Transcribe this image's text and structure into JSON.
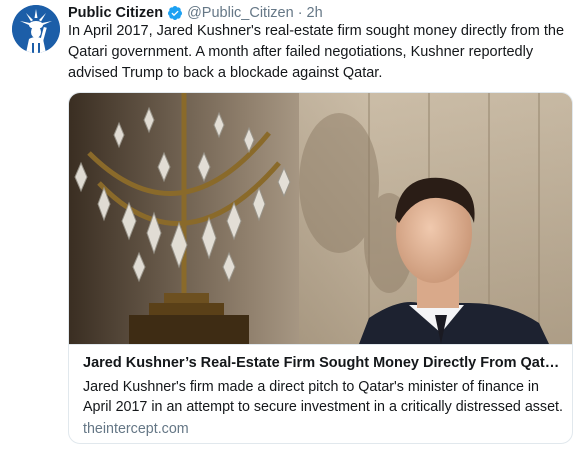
{
  "tweet": {
    "author_name": "Public Citizen",
    "handle": "@Public_Citizen",
    "separator": "·",
    "time": "2h",
    "verified": true,
    "verified_icon": "verified-badge-icon",
    "avatar_icon": "statue-of-liberty-logo",
    "text": "In April 2017, Jared Kushner's real-estate firm sought money directly from the Qatari government. A month after failed negotiations, Kushner reportedly advised Trump to back a blockade against Qatar."
  },
  "card": {
    "image_subject": "chandelier-and-man-in-suit-photo",
    "title": "Jared Kushner’s Real-Estate Firm Sought Money Directly From Qatar…",
    "description": "Jared Kushner's firm made a direct pitch to Qatar's minister of finance in April 2017 in an attempt to secure investment in a critically distressed asset.",
    "domain": "theintercept.com"
  },
  "colors": {
    "text": "#14171a",
    "secondary": "#657786",
    "verified": "#1da1f2",
    "border": "#e1e8ed",
    "avatar_bg": "#1c5ea8"
  }
}
